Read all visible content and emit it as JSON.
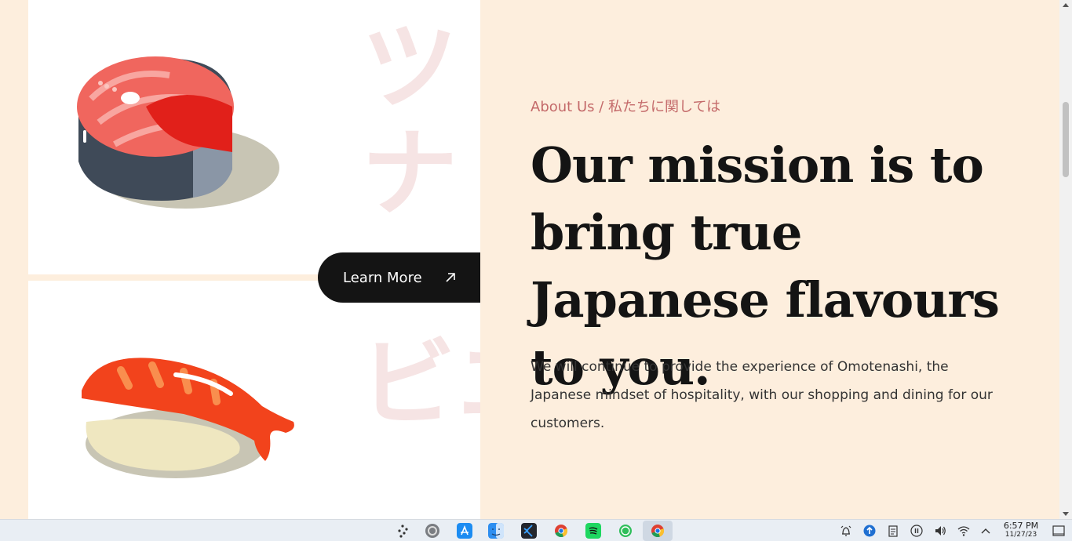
{
  "cards": [
    {
      "kana": "ツナ",
      "food_icon": "tuna-steak-illustration"
    },
    {
      "kana": "エビ",
      "food_icon": "shrimp-nigiri-illustration"
    }
  ],
  "learn_more": {
    "label": "Learn More",
    "icon": "arrow-up-right-icon"
  },
  "about": {
    "label": "About Us / 私たちに関しては",
    "headline": "Our mission is to bring true Japanese flavours to you.",
    "description": "We will continue to provide the experience of Omotenashi, the Japanese mindset of hospitality, with our shopping and dining for our customers."
  },
  "colors": {
    "page_bg": "#fdeedd",
    "accent": "#c46a6a",
    "button_bg": "#141414",
    "kana": "#f6e4e4"
  },
  "taskbar": {
    "apps": [
      "launcher-icon",
      "system-preferences-icon",
      "app-store-icon",
      "finder-icon",
      "vscode-icon",
      "chrome-icon",
      "spotify-icon",
      "whatsapp-icon",
      "chrome-active-icon"
    ],
    "tray": [
      "alarm-icon",
      "update-icon",
      "clipboard-icon",
      "pause-icon",
      "volume-icon",
      "wifi-icon",
      "chevron-up-icon"
    ],
    "time": "6:57 PM",
    "date": "11/27/23"
  }
}
